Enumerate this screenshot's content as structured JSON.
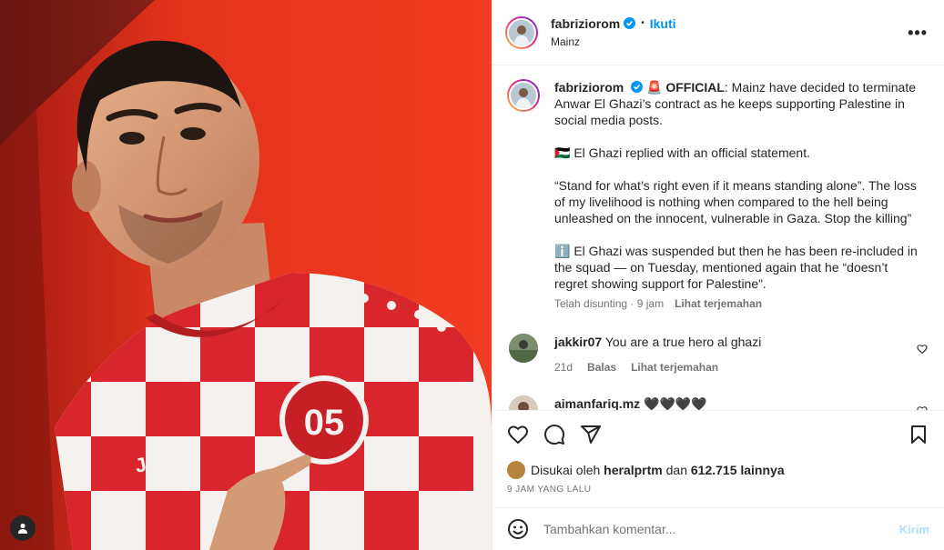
{
  "post": {
    "username": "fabriziorom",
    "follow_label": "Ikuti",
    "location": "Mainz",
    "more_label": "•••"
  },
  "caption": {
    "username": "fabriziorom",
    "emoji_prefix": "🚨",
    "headline": "OFFICIAL",
    "lines": [
      ": Mainz have decided to terminate Anwar El Ghazi’s contract as he keeps supporting Palestine in social media posts.",
      "🇵🇸 El Ghazi replied with an official statement.",
      "“Stand for what’s right even if it means standing alone”. The loss of my livelihood is nothing when compared to the hell being unleashed on the innocent, vulnerable in Gaza. Stop the killing”",
      "ℹ️ El Ghazi was suspended but then he has been re-included in the squad — on Tuesday, mentioned again that he “doesn’t regret showing support for Palestine”."
    ],
    "edited": "Telah disunting · 9 jam",
    "translate": "Lihat terjemahan"
  },
  "comments": [
    {
      "username": "jakkir07",
      "text": "You are a true hero al ghazi",
      "age": "21d",
      "reply": "Balas",
      "translate": "Lihat terjemahan"
    },
    {
      "username": "aimanfariq.mz",
      "text": "🖤🖤🖤🖤"
    }
  ],
  "likes": {
    "prefix": "Disukai oleh",
    "user": "heralprtm",
    "middle": "dan",
    "count": "612.715 lainnya"
  },
  "timestamp": "9 JAM YANG LALU",
  "composer": {
    "placeholder": "Tambahkan komentar...",
    "post_label": "Kirim"
  },
  "colors": {
    "accent": "#0095f6",
    "jersey_red": "#d8262c",
    "background_red": "#e0301b"
  },
  "icons": [
    "verified-icon",
    "heart-icon",
    "comment-icon",
    "share-icon",
    "bookmark-icon",
    "emoji-icon",
    "user-tag-icon",
    "more-icon"
  ]
}
